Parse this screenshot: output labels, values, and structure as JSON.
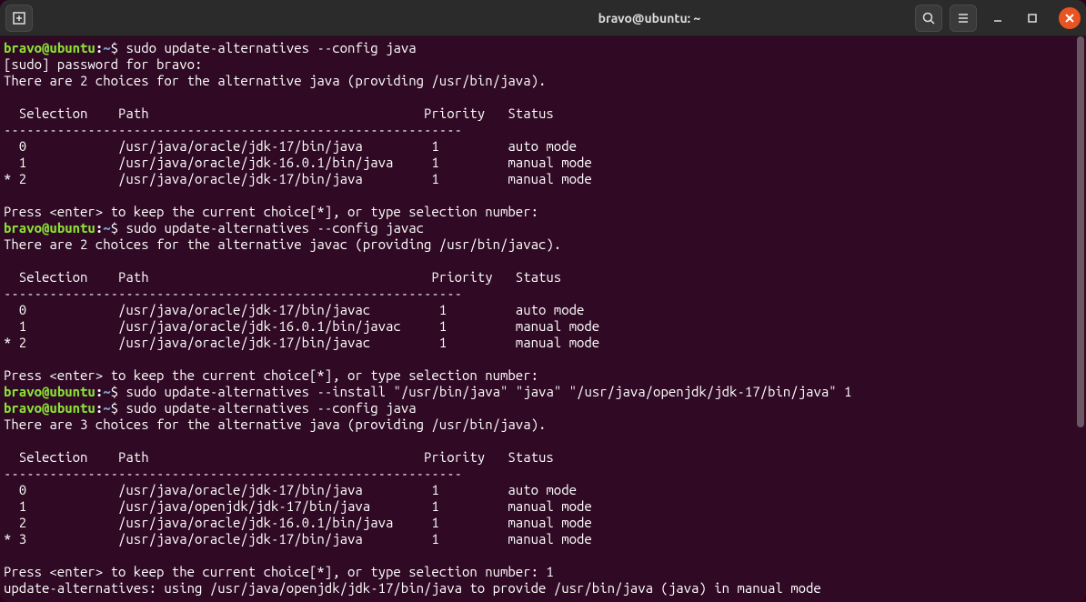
{
  "titlebar": {
    "title": "bravo@ubuntu: ~"
  },
  "prompt": {
    "user": "bravo",
    "at": "@",
    "host": "ubuntu",
    "colon": ":",
    "path": "~",
    "dollar": "$ "
  },
  "cmds": {
    "c1": "sudo update-alternatives --config java",
    "c2": "sudo update-alternatives --config javac",
    "c3": "sudo update-alternatives --install \"/usr/bin/java\" \"java\" \"/usr/java/openjdk/jdk-17/bin/java\" 1",
    "c4": "sudo update-alternatives --config java"
  },
  "out": {
    "l01": "[sudo] password for bravo:",
    "l02": "There are 2 choices for the alternative java (providing /usr/bin/java).",
    "blank": "",
    "hdr": "  Selection    Path                                    Priority   Status",
    "sep": "------------------------------------------------------------",
    "j0": "  0            /usr/java/oracle/jdk-17/bin/java         1         auto mode",
    "j1": "  1            /usr/java/oracle/jdk-16.0.1/bin/java     1         manual mode",
    "j2": "* 2            /usr/java/oracle/jdk-17/bin/java         1         manual mode",
    "press": "Press <enter> to keep the current choice[*], or type selection number:",
    "l10": "There are 2 choices for the alternative javac (providing /usr/bin/javac).",
    "hdr2": "  Selection    Path                                     Priority   Status",
    "c0": "  0            /usr/java/oracle/jdk-17/bin/javac         1         auto mode",
    "c1r": "  1            /usr/java/oracle/jdk-16.0.1/bin/javac     1         manual mode",
    "c2r": "* 2            /usr/java/oracle/jdk-17/bin/javac         1         manual mode",
    "l20": "There are 3 choices for the alternative java (providing /usr/bin/java).",
    "k0": "  0            /usr/java/oracle/jdk-17/bin/java         1         auto mode",
    "k1": "  1            /usr/java/openjdk/jdk-17/bin/java        1         manual mode",
    "k2": "  2            /usr/java/oracle/jdk-16.0.1/bin/java     1         manual mode",
    "k3": "* 3            /usr/java/oracle/jdk-17/bin/java         1         manual mode",
    "press1": "Press <enter> to keep the current choice[*], or type selection number: 1",
    "final": "update-alternatives: using /usr/java/openjdk/jdk-17/bin/java to provide /usr/bin/java (java) in manual mode"
  }
}
